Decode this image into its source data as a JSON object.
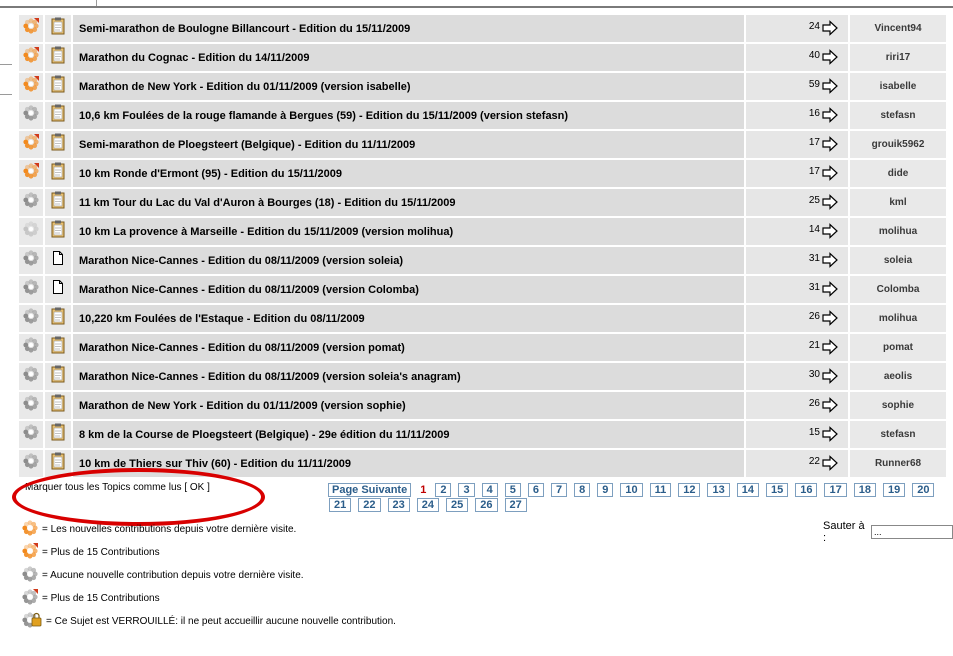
{
  "topics": [
    {
      "icon": "new-hot",
      "type": "clipboard",
      "title": "Semi-marathon de Boulogne Billancourt - Edition du 15/11/2009",
      "replies": "24",
      "author": "Vincent94"
    },
    {
      "icon": "new-hot",
      "type": "clipboard",
      "title": "Marathon du Cognac - Edition du 14/11/2009",
      "replies": "40",
      "author": "riri17"
    },
    {
      "icon": "new-hot",
      "type": "clipboard",
      "title": "Marathon de New York - Edition du 01/11/2009 (version isabelle)",
      "replies": "59",
      "author": "isabelle"
    },
    {
      "icon": "read",
      "type": "clipboard",
      "title": "10,6 km Foulées de la rouge flamande à Bergues (59) - Edition du 15/11/2009 (version stefasn)",
      "replies": "16",
      "author": "stefasn"
    },
    {
      "icon": "new-hot",
      "type": "clipboard",
      "title": "Semi-marathon de Ploegsteert (Belgique) - Edition du 11/11/2009",
      "replies": "17",
      "author": "grouik5962"
    },
    {
      "icon": "new-hot",
      "type": "clipboard",
      "title": "10 km Ronde d'Ermont (95) - Edition du 15/11/2009",
      "replies": "17",
      "author": "dide"
    },
    {
      "icon": "read",
      "type": "clipboard",
      "title": "11 km Tour du Lac du Val d'Auron à Bourges (18) - Edition du 15/11/2009",
      "replies": "25",
      "author": "kml"
    },
    {
      "icon": "read-light",
      "type": "clipboard",
      "title": "10 km La provence à Marseille - Edition du 15/11/2009 (version molihua)",
      "replies": "14",
      "author": "molihua"
    },
    {
      "icon": "read",
      "type": "page",
      "title": "Marathon Nice-Cannes - Edition du 08/11/2009 (version soleia)",
      "replies": "31",
      "author": "soleia"
    },
    {
      "icon": "read",
      "type": "page",
      "title": "Marathon Nice-Cannes - Edition du 08/11/2009 (version Colomba)",
      "replies": "31",
      "author": "Colomba"
    },
    {
      "icon": "read",
      "type": "clipboard",
      "title": "10,220 km Foulées de l'Estaque - Edition du 08/11/2009",
      "replies": "26",
      "author": "molihua"
    },
    {
      "icon": "read",
      "type": "clipboard",
      "title": "Marathon Nice-Cannes - Edition du 08/11/2009 (version pomat)",
      "replies": "21",
      "author": "pomat"
    },
    {
      "icon": "read",
      "type": "clipboard",
      "title": "Marathon Nice-Cannes - Edition du 08/11/2009 (version soleia's anagram)",
      "replies": "30",
      "author": "aeolis"
    },
    {
      "icon": "read",
      "type": "clipboard",
      "title": "Marathon de New York - Edition du 01/11/2009 (version sophie)",
      "replies": "26",
      "author": "sophie"
    },
    {
      "icon": "read",
      "type": "clipboard",
      "title": "8 km de la Course de Ploegsteert (Belgique) - 29e édition du 11/11/2009",
      "replies": "15",
      "author": "stefasn"
    },
    {
      "icon": "read",
      "type": "clipboard",
      "title": "10 km de Thiers sur Thiv (60) - Edition du 11/11/2009",
      "replies": "22",
      "author": "Runner68"
    }
  ],
  "mark_all": {
    "text": "Marquer tous les Topics comme lus [",
    "ok": " OK ",
    "close": "]"
  },
  "pagination": {
    "next_label": "Page Suivante",
    "current": "1",
    "row1": [
      "2",
      "3",
      "4",
      "5",
      "6",
      "7",
      "8",
      "9",
      "10",
      "11",
      "12",
      "13",
      "14",
      "15",
      "16",
      "17",
      "18",
      "19",
      "20"
    ],
    "row2": [
      "21",
      "22",
      "23",
      "24",
      "25",
      "26",
      "27"
    ]
  },
  "jump": {
    "label": "Sauter à :",
    "value": "..."
  },
  "legend": [
    {
      "icon": "new",
      "text": "= Les nouvelles contributions depuis votre dernière visite."
    },
    {
      "icon": "new-hot",
      "text": "= Plus de 15 Contributions"
    },
    {
      "icon": "read",
      "text": "= Aucune nouvelle contribution depuis votre dernière visite."
    },
    {
      "icon": "read-hot",
      "text": "= Plus de 15 Contributions"
    },
    {
      "icon": "locked",
      "text": "= Ce Sujet est VERROUILLÉ: il ne peut accueillir aucune nouvelle contribution."
    }
  ],
  "colors": {
    "new": "#f28a1e",
    "read": "#8c8c8c",
    "read_light": "#c4c4c4",
    "lock": "#e0a020",
    "pager": "#2b5d8a",
    "current_page": "#c00000",
    "highlight": "#d80000"
  }
}
